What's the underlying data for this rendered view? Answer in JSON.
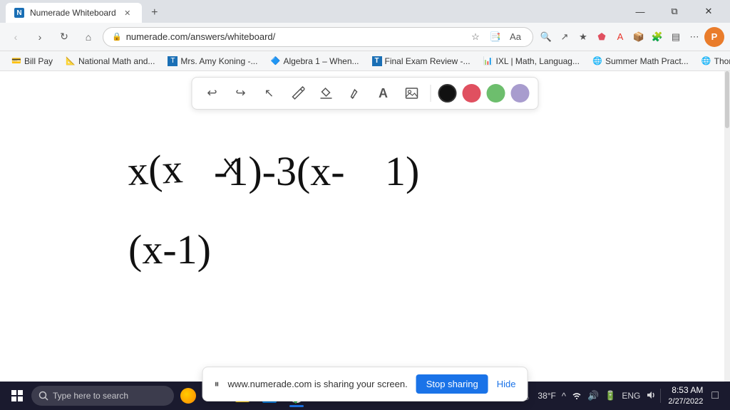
{
  "browser": {
    "tab": {
      "title": "Numerade Whiteboard",
      "favicon_char": "N"
    },
    "address": "numerade.com/answers/whiteboard/",
    "address_display": "numerade.com/answers/whiteboard/"
  },
  "bookmarks": [
    {
      "label": "Bill Pay",
      "favicon": "💳"
    },
    {
      "label": "National Math and...",
      "favicon": "📐"
    },
    {
      "label": "Mrs. Amy Koning -...",
      "favicon": "📋"
    },
    {
      "label": "Algebra 1 – When...",
      "favicon": "🔷"
    },
    {
      "label": "Final Exam Review -...",
      "favicon": "📄"
    },
    {
      "label": "IXL | Math, Languag...",
      "favicon": "📊"
    },
    {
      "label": "Summer Math Pract...",
      "favicon": "🌐"
    },
    {
      "label": "Thomastik-Infeld C...",
      "favicon": "🌐"
    }
  ],
  "toolbar": {
    "tools": [
      {
        "name": "undo",
        "symbol": "↩"
      },
      {
        "name": "redo",
        "symbol": "↪"
      },
      {
        "name": "select",
        "symbol": "↖"
      },
      {
        "name": "pen",
        "symbol": "✏"
      },
      {
        "name": "eraser",
        "symbol": "✂"
      },
      {
        "name": "highlighter",
        "symbol": "🖊"
      },
      {
        "name": "text",
        "symbol": "A"
      },
      {
        "name": "image",
        "symbol": "🖼"
      }
    ],
    "colors": [
      {
        "name": "black",
        "hex": "#111111",
        "selected": true
      },
      {
        "name": "red",
        "hex": "#e05060"
      },
      {
        "name": "green",
        "hex": "#6dbe6d"
      },
      {
        "name": "purple",
        "hex": "#a89cce"
      }
    ]
  },
  "whiteboard": {
    "formula_line1": "x(x-1)-3(x-1)",
    "formula_line2": "(x-1)"
  },
  "sharing_banner": {
    "icon": "⏸",
    "text": "www.numerade.com is sharing your screen.",
    "stop_label": "Stop sharing",
    "hide_label": "Hide"
  },
  "taskbar": {
    "search_placeholder": "Type here to search",
    "apps": [
      {
        "name": "windows",
        "icon": "⊞"
      },
      {
        "name": "cortana",
        "icon": "●"
      },
      {
        "name": "task-view",
        "icon": "⧉"
      },
      {
        "name": "file-explorer",
        "icon": "📁"
      },
      {
        "name": "chrome",
        "icon": "⬤"
      }
    ],
    "sys_tray": {
      "weather": "38°F",
      "time": "8:53 AM",
      "date": "2/27/2022"
    }
  }
}
